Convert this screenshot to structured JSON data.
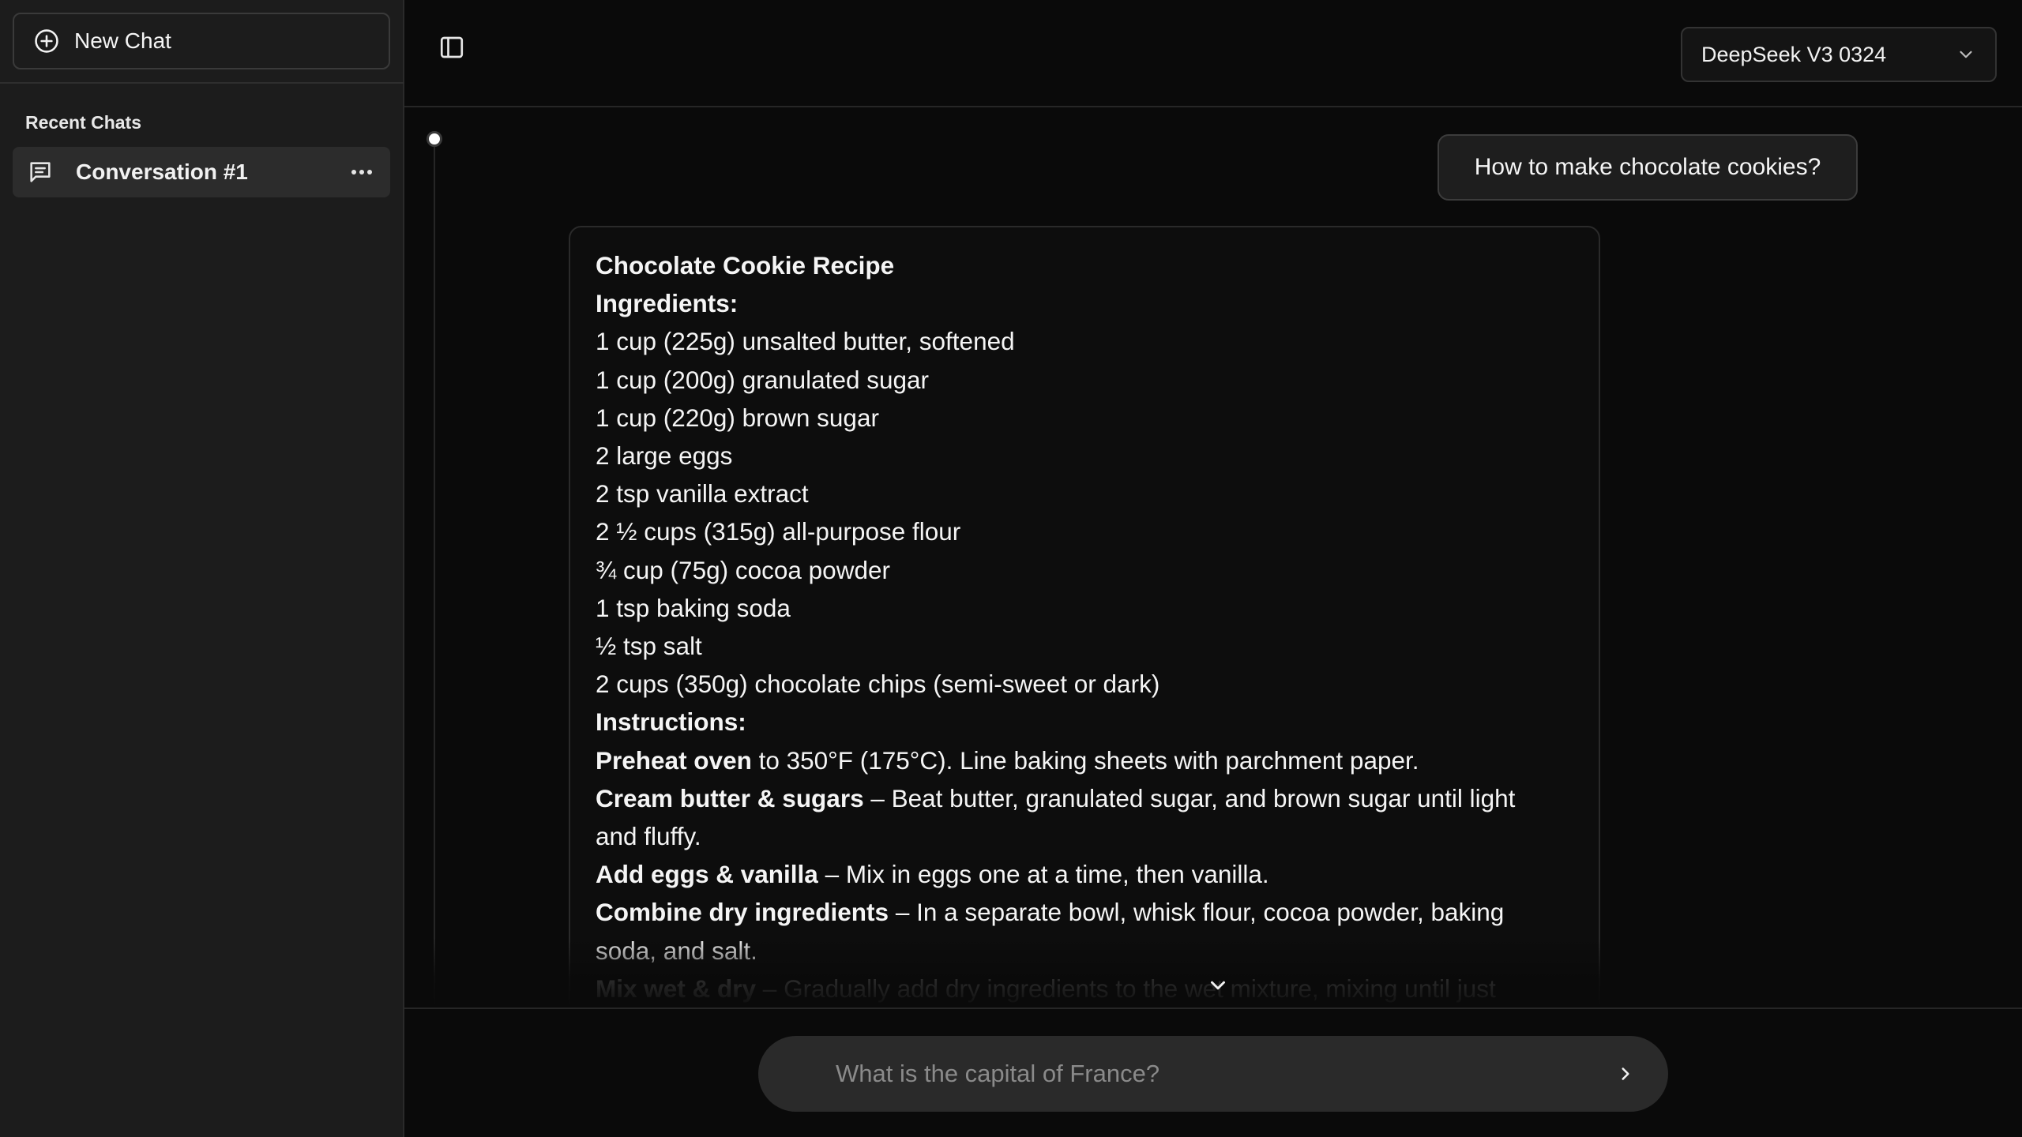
{
  "sidebar": {
    "new_chat_label": "New Chat",
    "recent_title": "Recent Chats",
    "chats": [
      {
        "label": "Conversation #1"
      }
    ]
  },
  "header": {
    "model": "DeepSeek V3 0324"
  },
  "messages": {
    "user": "How to make chocolate cookies?",
    "assistant": {
      "title": "Chocolate Cookie Recipe",
      "ingredients_heading": "Ingredients:",
      "ingredients": [
        "1 cup (225g) unsalted butter, softened",
        "1 cup (200g) granulated sugar",
        "1 cup (220g) brown sugar",
        "2 large eggs",
        "2 tsp vanilla extract",
        "2 ½ cups (315g) all-purpose flour",
        "¾ cup (75g) cocoa powder",
        "1 tsp baking soda",
        "½ tsp salt",
        "2 cups (350g) chocolate chips (semi-sweet or dark)"
      ],
      "instructions_heading": "Instructions:",
      "steps": [
        {
          "bold": "Preheat oven",
          "text": " to 350°F (175°C). Line baking sheets with parchment paper."
        },
        {
          "bold": "Cream butter & sugars",
          "text": " – Beat butter, granulated sugar, and brown sugar until light",
          "text2": "and fluffy."
        },
        {
          "bold": "Add eggs & vanilla",
          "text": " – Mix in eggs one at a time, then vanilla."
        },
        {
          "bold": "Combine dry ingredients",
          "text": " – In a separate bowl, whisk flour, cocoa powder, baking",
          "text2": "soda, and salt."
        },
        {
          "bold": "Mix wet & dry",
          "text": " – Gradually add dry ingredients to the wet mixture, mixing until just"
        }
      ]
    }
  },
  "composer": {
    "placeholder": "What is the capital of France?"
  },
  "icons": {
    "new_chat": "plus-circle-icon",
    "chat": "message-square-icon",
    "more": "more-horizontal-icon",
    "sidebar_toggle": "sidebar-toggle-icon",
    "chevron": "chevron-down-icon",
    "scroll": "chevron-down-icon",
    "send": "chevron-right-icon"
  }
}
